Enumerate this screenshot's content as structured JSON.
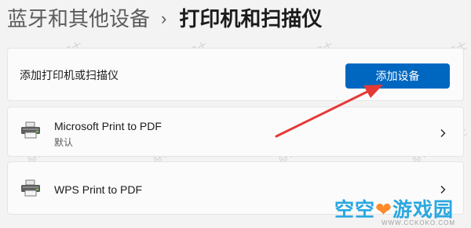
{
  "breadcrumb": {
    "parent": "蓝牙和其他设备",
    "separator": "›",
    "current": "打印机和扫描仪"
  },
  "add_printer": {
    "label": "添加打印机或扫描仪",
    "button_label": "添加设备"
  },
  "devices": [
    {
      "name": "Microsoft Print to PDF",
      "status": "默认",
      "icon": "printer-icon"
    },
    {
      "name": "WPS Print to PDF",
      "status": "",
      "icon": "printer-icon"
    }
  ],
  "watermark": "@打印机卫士",
  "logo": {
    "text": "空空",
    "text2": "游戏园",
    "sub": "WWW.CCKOKO.COM"
  },
  "colors": {
    "accent": "#0067c0",
    "annotation_arrow": "#e53935",
    "logo": "#2aa7e0"
  }
}
